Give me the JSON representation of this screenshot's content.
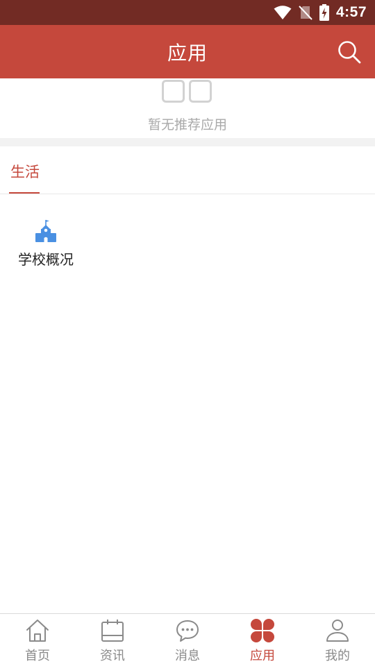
{
  "status_bar": {
    "time": "4:57"
  },
  "header": {
    "title": "应用"
  },
  "recommend": {
    "empty_text": "暂无推荐应用"
  },
  "tabs": [
    {
      "label": "生活",
      "active": true
    }
  ],
  "apps": [
    {
      "label": "学校概况",
      "icon": "school-icon"
    }
  ],
  "bottom_nav": {
    "items": [
      {
        "label": "首页",
        "icon": "home-icon"
      },
      {
        "label": "资讯",
        "icon": "calendar-icon"
      },
      {
        "label": "消息",
        "icon": "chat-bubble-icon"
      },
      {
        "label": "应用",
        "icon": "apps-icon",
        "active": true
      },
      {
        "label": "我的",
        "icon": "user-icon"
      }
    ]
  },
  "colors": {
    "status_bar": "#722b24",
    "primary": "#c5483c",
    "inactive": "#8a8a8a",
    "app_icon": "#4a90e2"
  }
}
